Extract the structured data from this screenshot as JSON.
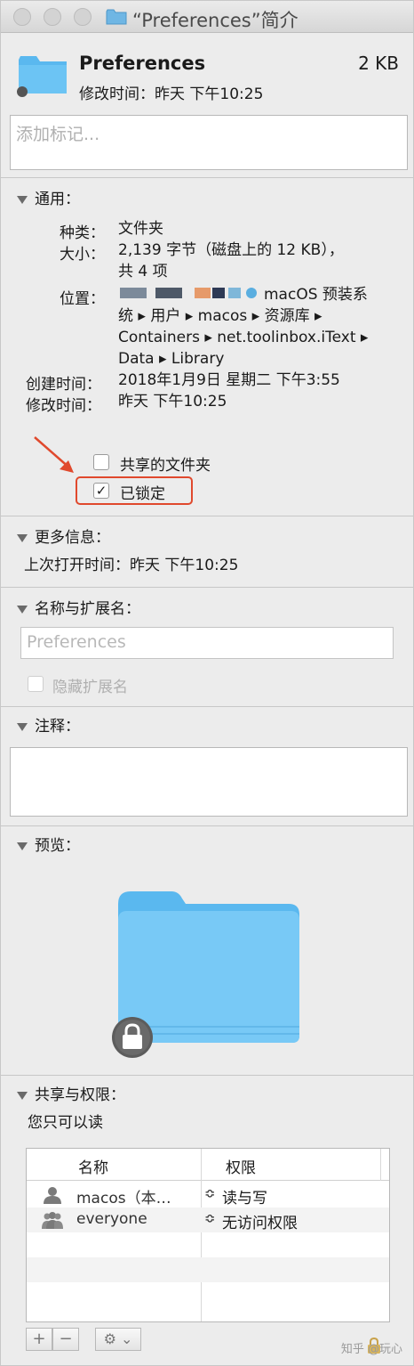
{
  "window": {
    "title": "“Preferences”简介"
  },
  "header": {
    "filename": "Preferences",
    "size": "2 KB",
    "modified": "修改时间：昨天 下午10:25",
    "tags_placeholder": "添加标记..."
  },
  "general": {
    "heading": "通用：",
    "kind_label": "种类：",
    "kind_value": "文件夹",
    "size_label": "大小：",
    "size_value_1": "2,139 字节（磁盘上的 12 KB），",
    "size_value_2": "共 4 项",
    "where_label": "位置：",
    "where_value_1": "macOS 预装系",
    "where_value_2": "统 ▸ 用户 ▸ macos ▸ 资源库 ▸",
    "where_value_3": "Containers ▸ net.toolinbox.iText ▸",
    "where_value_4": "Data ▸ Library",
    "created_label": "创建时间：",
    "created_value": "2018年1月9日 星期二 下午3:55",
    "modified_label": "修改时间：",
    "modified_value": "昨天 下午10:25",
    "shared_folder_label": "共享的文件夹",
    "shared_folder_checked": false,
    "locked_label": "已锁定",
    "locked_checked": true,
    "check_mark": "✓"
  },
  "more_info": {
    "heading": "更多信息：",
    "last_opened": "上次打开时间：昨天 下午10:25"
  },
  "name_ext": {
    "heading": "名称与扩展名：",
    "name_value": "Preferences",
    "hide_ext_label": "隐藏扩展名"
  },
  "comments": {
    "heading": "注释："
  },
  "preview": {
    "heading": "预览："
  },
  "sharing": {
    "heading": "共享与权限：",
    "status": "您只可以读",
    "col_name": "名称",
    "col_privilege": "权限",
    "rows": [
      {
        "name": "macos（本…",
        "privilege": "读与写",
        "updown": "≎"
      },
      {
        "name": "everyone",
        "privilege": "无访问权限",
        "updown": "≎"
      }
    ],
    "add_btn": "+",
    "remove_btn": "−",
    "action_btn": "⚙ ⌄"
  },
  "watermark": "知乎 @玩心",
  "colors": {
    "folder_blue": "#5ab8ef",
    "highlight_red": "#e0492d"
  }
}
